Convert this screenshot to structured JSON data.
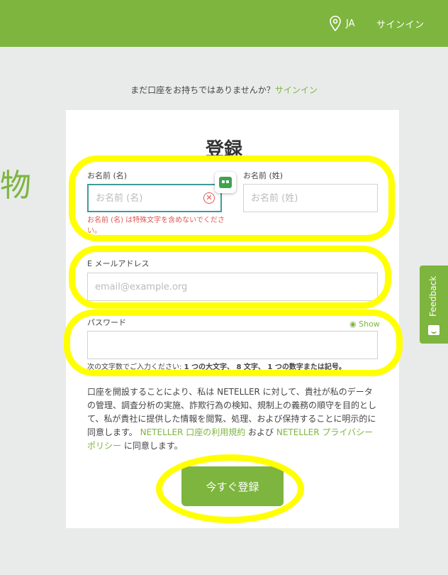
{
  "header": {
    "lang": "JA",
    "signin_label": "サインイン"
  },
  "background_char": "物",
  "account_prompt": {
    "text": "まだ口座をお持ちではありませんか？",
    "link": "サインイン"
  },
  "form": {
    "title": "登録",
    "first_name": {
      "label": "お名前 (名)",
      "placeholder": "お名前 (名)",
      "value": "",
      "error": "お名前 (名) は特殊文字を含めないでください。"
    },
    "last_name": {
      "label": "お名前 (姓)",
      "placeholder": "お名前 (姓)",
      "value": ""
    },
    "email": {
      "label": "E メールアドレス",
      "placeholder": "email@example.org",
      "value": ""
    },
    "password": {
      "label": "パスワード",
      "show_label": "Show",
      "value": "",
      "hint_prefix": "次の文字数でご入力ください: ",
      "hint_rule": "1 つの大文字、 8 文字、 1 つの数字または記号。"
    },
    "terms": {
      "text1": "口座を開設することにより、私は NETELLER に対して、貴社が私のデータの管理、調査分析の実施、詐欺行為の検知、規制上の義務の順守を目的として、私が貴社に提供した情報を閲覧、処理、および保持することに明示的に同意します。 ",
      "link1": "NETELLER 口座の利用規約",
      "text2": " および ",
      "link2": "NETELLER プライバシー ポリシー",
      "text3": " に同意します。"
    },
    "submit_label": "今すぐ登録"
  },
  "feedback_tab": {
    "label": "Feedback"
  },
  "colors": {
    "brand_green": "#7db53f",
    "error_red": "#e05656",
    "highlight_yellow": "#ffff00",
    "focus_teal": "#3f9a9a"
  }
}
